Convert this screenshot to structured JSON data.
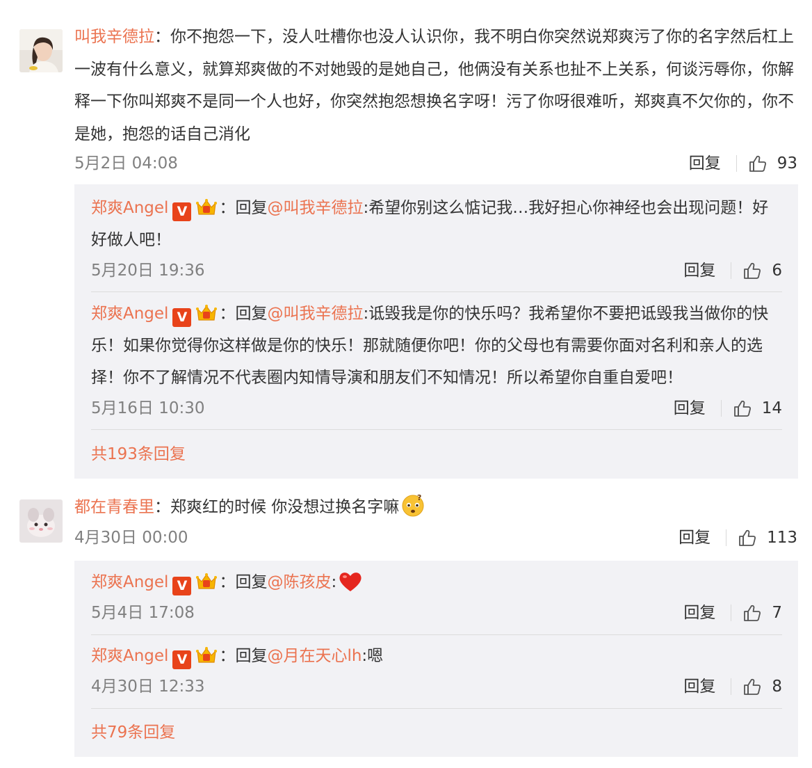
{
  "comments": [
    {
      "user": "叫我辛德拉",
      "text": "你不抱怨一下，没人吐槽你也没人认识你，我不明白你突然说郑爽污了你的名字然后杠上一波有什么意义，就算郑爽做的不对她毁的是她自己，他俩没有关系也扯不上关系，何谈污辱你，你解释一下你叫郑爽不是同一个人也好，你突然抱怨想换名字呀！污了你呀很难听，郑爽真不欠你的，你不是她，抱怨的话自己消化",
      "time": "5月2日 04:08",
      "reply_label": "回复",
      "likes": "93",
      "replies": [
        {
          "user": "郑爽Angel",
          "v_badge": "V",
          "reply_prefix": "回复",
          "mention": "@叫我辛德拉",
          "text": ":希望你别这么惦记我…我好担心你神经也会出现问题！好好做人吧！",
          "time": "5月20日 19:36",
          "reply_label": "回复",
          "likes": "6"
        },
        {
          "user": "郑爽Angel",
          "v_badge": "V",
          "reply_prefix": "回复",
          "mention": "@叫我辛德拉",
          "text": ":诋毁我是你的快乐吗？我希望你不要把诋毁我当做你的快乐！如果你觉得你这样做是你的快乐！那就随便你吧！你的父母也有需要你面对名利和亲人的选择！你不了解情况不代表圈内知情导演和朋友们不知情况！所以希望你自重自爱吧！",
          "time": "5月16日 10:30",
          "reply_label": "回复",
          "likes": "14"
        }
      ],
      "more_replies": "共193条回复"
    },
    {
      "user": "都在青春里",
      "text": "郑爽红的时候 你没想过换名字嘛",
      "emoji": "thinking-emoji",
      "time": "4月30日 00:00",
      "reply_label": "回复",
      "likes": "113",
      "replies": [
        {
          "user": "郑爽Angel",
          "v_badge": "V",
          "reply_prefix": "回复",
          "mention": "@陈孩皮",
          "text": ":",
          "emoji": "red-heart-emoji",
          "time": "5月4日 17:08",
          "reply_label": "回复",
          "likes": "7"
        },
        {
          "user": "郑爽Angel",
          "v_badge": "V",
          "reply_prefix": "回复",
          "mention": "@月在天心lh",
          "text": ":嗯",
          "time": "4月30日 12:33",
          "reply_label": "回复",
          "likes": "8"
        }
      ],
      "more_replies": "共79条回复"
    }
  ],
  "colors": {
    "username": "#eb7350",
    "reply_bg": "#f2f2f5",
    "v_badge": "#e8431a",
    "timestamp": "#808080"
  },
  "icons": {
    "like": "thumbs-up-icon",
    "vip": "crown-icon",
    "verified": "verified-v-icon"
  }
}
